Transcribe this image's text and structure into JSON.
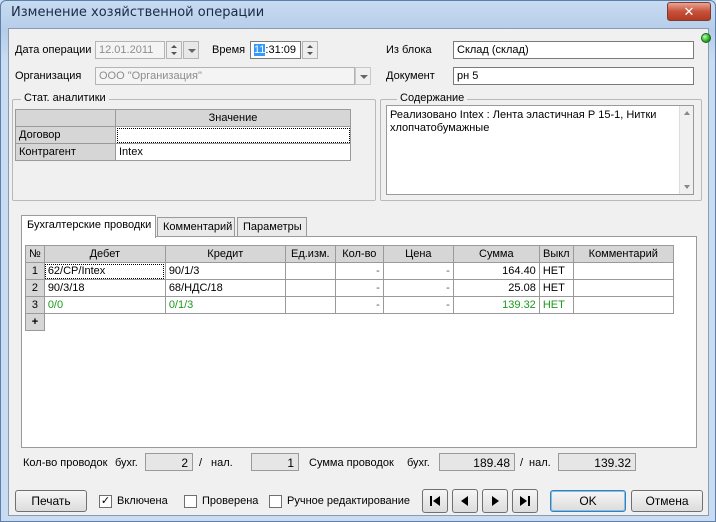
{
  "window": {
    "title": "Изменение хозяйственной операции",
    "close_label": "✕"
  },
  "header": {
    "date_label": "Дата операции",
    "date_value": "12.01.2011",
    "time_label": "Время",
    "time_hours": "11",
    "time_rest": ":31:09",
    "org_label": "Организация",
    "org_value": "ООО \"Организация\"",
    "block_label": "Из блока",
    "block_value": "Склад (склад)",
    "doc_label": "Документ",
    "doc_value": "рн 5"
  },
  "stat": {
    "title": "Стат. аналитики",
    "col_value": "Значение",
    "rows": [
      {
        "name": "Договор",
        "value": ""
      },
      {
        "name": "Контрагент",
        "value": "Intex"
      }
    ]
  },
  "content": {
    "title": "Содержание",
    "text": "Реализовано Intex : Лента эластичная Р 15-1, Нитки хлопчатобумажные"
  },
  "tabs": [
    {
      "label": "Бухгалтерские проводки"
    },
    {
      "label": "Комментарий"
    },
    {
      "label": "Параметры"
    }
  ],
  "entries": {
    "columns": [
      "№",
      "Дебет",
      "Кредит",
      "Ед.изм.",
      "Кол-во",
      "Цена",
      "Сумма",
      "Выкл",
      "Комментарий"
    ],
    "rows": [
      {
        "n": "1",
        "debit": "62/CP/Intex",
        "credit": "90/1/3",
        "unit": "",
        "qty": "-",
        "price": "-",
        "sum": "164.40",
        "off": "НЕТ",
        "comment": ""
      },
      {
        "n": "2",
        "debit": "90/3/18",
        "credit": "68/НДС/18",
        "unit": "",
        "qty": "-",
        "price": "-",
        "sum": "25.08",
        "off": "НЕТ",
        "comment": ""
      },
      {
        "n": "3",
        "debit": "0/0",
        "credit": "0/1/3",
        "unit": "",
        "qty": "-",
        "price": "-",
        "sum": "139.32",
        "off": "НЕТ",
        "comment": ""
      }
    ],
    "add_row": "+"
  },
  "totals": {
    "count_label": "Кол-во проводок",
    "buh_label": "бухг.",
    "count_buh": "2",
    "slash": "/",
    "nal_label": "нал.",
    "count_nal": "1",
    "sum_label": "Сумма проводок",
    "sum_buh_label": "бухг.",
    "sum_buh": "189.48",
    "sum_nal_label": "нал.",
    "sum_nal": "139.32"
  },
  "footer": {
    "print_label": "Печать",
    "enabled_label": "Включена",
    "checked_label": "Проверена",
    "manual_label": "Ручное редактирование",
    "ok_label": "OK",
    "cancel_label": "Отмена"
  },
  "colors": {
    "green_row": "#1a9a1a",
    "status_led": "#1fb31a"
  }
}
